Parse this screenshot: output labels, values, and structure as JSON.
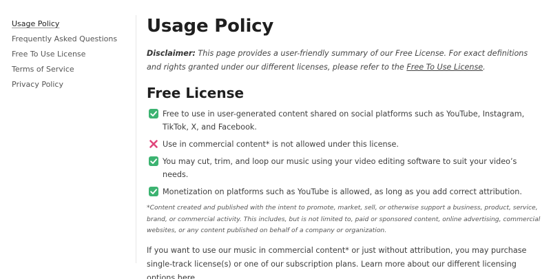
{
  "sidebar": {
    "items": [
      {
        "label": "Usage Policy",
        "active": true
      },
      {
        "label": "Frequently Asked Questions"
      },
      {
        "label": "Free To Use License"
      },
      {
        "label": "Terms of Service"
      },
      {
        "label": "Privacy Policy"
      }
    ]
  },
  "main": {
    "title": "Usage Policy",
    "disclaimer": {
      "label": "Disclaimer:",
      "text": " This page provides a user-friendly summary of our Free License. For exact definitions and rights granted under our different licenses, please refer to the ",
      "link": "Free To Use License",
      "end": "."
    },
    "section_title": "Free License",
    "rules": [
      {
        "icon": "check-icon",
        "text": "Free to use in user-generated content shared on social platforms such as YouTube, Instagram, TikTok, X, and Facebook."
      },
      {
        "icon": "cross-icon",
        "text": "Use in commercial content* is not allowed under this license."
      },
      {
        "icon": "check-icon",
        "text": "You may cut, trim, and loop our music using your video editing software to suit your video’s needs."
      },
      {
        "icon": "check-icon",
        "text": "Monetization on platforms such as YouTube is allowed, as long as you add correct attribution."
      }
    ],
    "footnote": "*Content created and published with the intent to promote, market, sell, or otherwise support a business, product, service, brand, or commercial activity. This includes, but is not limited to, paid or sponsored content, online advertising, commercial websites, or any content published on behalf of a company or organization.",
    "closing": {
      "text": "If you want to use our music in commercial content* or just without attribution, you may purchase single-track license(s) or one of our subscription plans. Learn more about our different licensing options ",
      "link": "here",
      "end": "."
    }
  },
  "colors": {
    "check": "#3cb371",
    "cross": "#e0457b"
  }
}
